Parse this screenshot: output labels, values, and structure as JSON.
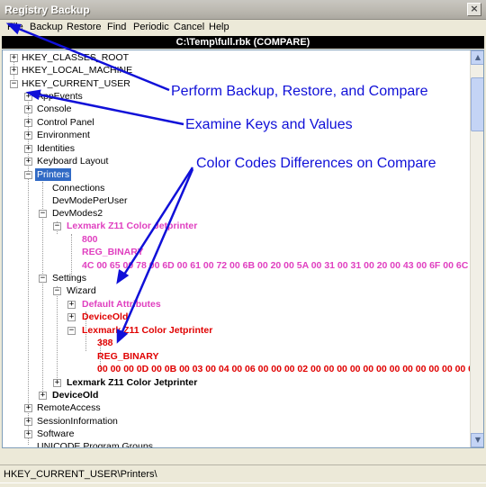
{
  "window": {
    "title": "Registry Backup",
    "close_glyph": "×"
  },
  "menu": [
    "File",
    "Backup",
    "Restore",
    "Find",
    "Periodic",
    "Cancel",
    "Help"
  ],
  "path": "C:\\Temp\\full.rbk  (COMPARE)",
  "tree": {
    "hkcr": "HKEY_CLASSES_ROOT",
    "hklm": "HKEY_LOCAL_MACHINE",
    "hkcu": "HKEY_CURRENT_USER",
    "appevents": "AppEvents",
    "console": "Console",
    "control_panel": "Control Panel",
    "environment": "Environment",
    "identities": "Identities",
    "keyboard_layout": "Keyboard Layout",
    "printers": "Printers",
    "connections": "Connections",
    "devmodeperuser": "DevModePerUser",
    "devmodes2": "DevModes2",
    "lexmark_pink": "Lexmark Z11 Color Jetprinter",
    "v800": "800",
    "reg_binary_pink": "REG_BINARY",
    "hex_pink": "4C 00 65 00 78 00 6D 00 61 00 72 00 6B 00 20 00 5A 00 31 00 31 00 20 00 43 00 6F 00 6C 00 6F 0",
    "settings": "Settings",
    "wizard": "Wizard",
    "default_attributes": "Default Attributes",
    "deviceold_pink": "DeviceOld",
    "lexmark_red": "Lexmark Z11 Color Jetprinter",
    "v388": "388",
    "reg_binary_red": "REG_BINARY",
    "hex_red": "00 00 00 0D 00 0B 00 03 00 04 00 06 00 00 00 02 00 00 00 00 00 00 00 00 00 00 00 00 00 00 00 0",
    "lexmark_black": "Lexmark Z11 Color Jetprinter",
    "deviceold_black": "DeviceOld",
    "remote_access": "RemoteAccess",
    "session_information": "SessionInformation",
    "software": "Software",
    "unicode": "UNICODE Program Groups"
  },
  "annotations": {
    "a1": "Perform Backup, Restore, and Compare",
    "a2": "Examine Keys and Values",
    "a3": "Color Codes Differences on Compare"
  },
  "status": "HKEY_CURRENT_USER\\Printers\\",
  "colors": {
    "annotation": "#1010d8",
    "changed": "#e040c0",
    "different": "#e00000",
    "selection": "#316ac5"
  }
}
